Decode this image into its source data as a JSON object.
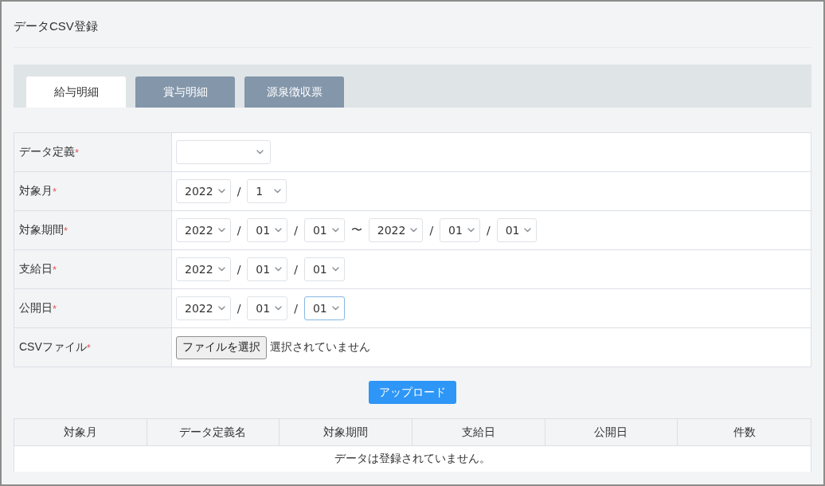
{
  "page": {
    "title": "データCSV登録"
  },
  "tabs": [
    {
      "label": "給与明細",
      "selected": true
    },
    {
      "label": "賞与明細",
      "selected": false
    },
    {
      "label": "源泉徴収票",
      "selected": false
    }
  ],
  "form": {
    "rows": [
      {
        "label": "データ定義",
        "required_mark": "*",
        "controls": [
          {
            "kind": "select",
            "focused": false
          }
        ]
      },
      {
        "label": "対象月",
        "required_mark": "*",
        "controls": [
          {
            "kind": "select",
            "value": "2022",
            "focused": false
          },
          {
            "kind": "separator",
            "text": "/"
          },
          {
            "kind": "select",
            "value": "1",
            "focused": false
          }
        ]
      },
      {
        "label": "対象期間",
        "required_mark": "*",
        "controls": [
          {
            "kind": "select",
            "value": "2022",
            "focused": false
          },
          {
            "kind": "separator",
            "text": "/"
          },
          {
            "kind": "select",
            "value": "01",
            "focused": false
          },
          {
            "kind": "separator",
            "text": "/"
          },
          {
            "kind": "select",
            "value": "01",
            "focused": false
          },
          {
            "kind": "separator",
            "text": "〜"
          },
          {
            "kind": "select",
            "value": "2022",
            "focused": false
          },
          {
            "kind": "separator",
            "text": "/"
          },
          {
            "kind": "select",
            "value": "01",
            "focused": false
          },
          {
            "kind": "separator",
            "text": "/"
          },
          {
            "kind": "select",
            "value": "01",
            "focused": false
          }
        ]
      },
      {
        "label": "支給日",
        "required_mark": "*",
        "controls": [
          {
            "kind": "select",
            "value": "2022",
            "focused": false
          },
          {
            "kind": "separator",
            "text": "/"
          },
          {
            "kind": "select",
            "value": "01",
            "focused": false
          },
          {
            "kind": "separator",
            "text": "/"
          },
          {
            "kind": "select",
            "value": "01",
            "focused": false
          }
        ]
      },
      {
        "label": "公開日",
        "required_mark": "*",
        "controls": [
          {
            "kind": "select",
            "value": "2022",
            "focused": false
          },
          {
            "kind": "separator",
            "text": "/"
          },
          {
            "kind": "select",
            "value": "01",
            "focused": false
          },
          {
            "kind": "separator",
            "text": "/"
          },
          {
            "kind": "select",
            "value": "01",
            "focused": true
          }
        ]
      },
      {
        "label": "CSVファイル",
        "required_mark": "*",
        "controls": [
          {
            "kind": "file",
            "button": "ファイルを選択",
            "status": "選択されていません"
          }
        ]
      }
    ]
  },
  "upload_button": {
    "label": "アップロード"
  },
  "results_table": {
    "columns": [
      "対象月",
      "データ定義名",
      "対象期間",
      "支給日",
      "公開日",
      "件数"
    ],
    "empty_message": "データは登録されていません。"
  }
}
